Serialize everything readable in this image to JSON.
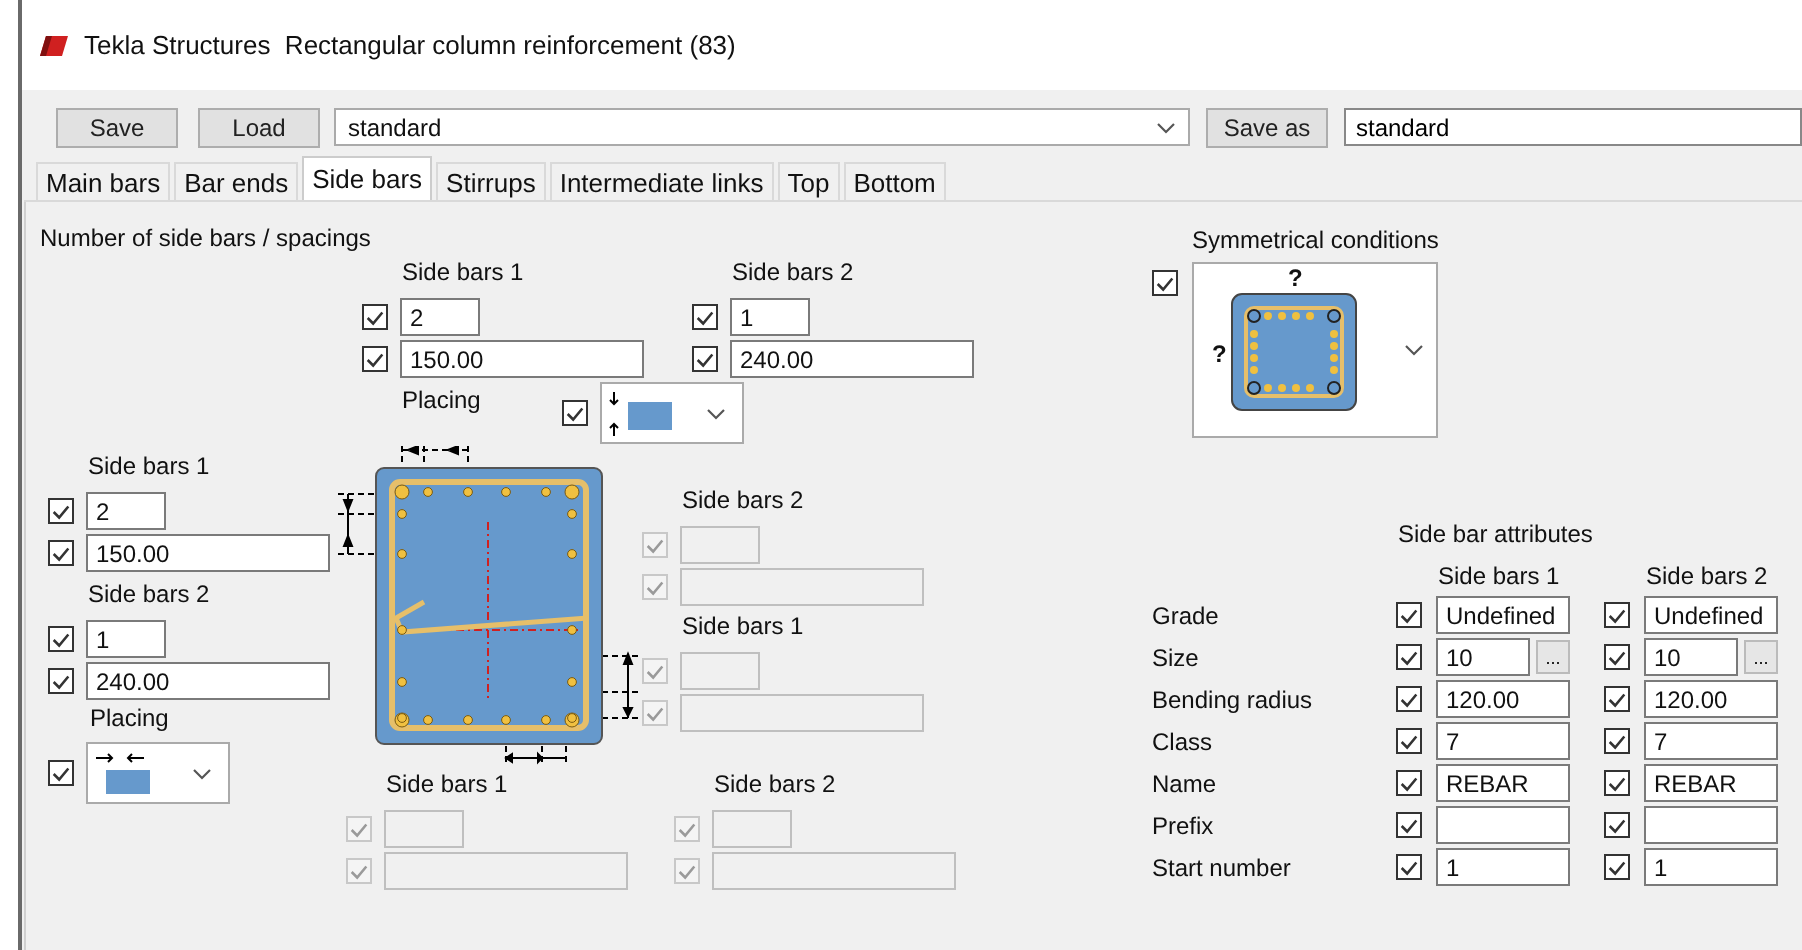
{
  "window": {
    "title": "Tekla Structures  Rectangular column reinforcement (83)"
  },
  "toolbar": {
    "save": "Save",
    "load": "Load",
    "preset": "standard",
    "save_as": "Save as",
    "save_as_name": "standard"
  },
  "tabs": [
    {
      "label": "Main bars",
      "selected": false
    },
    {
      "label": "Bar ends",
      "selected": false
    },
    {
      "label": "Side bars",
      "selected": true
    },
    {
      "label": "Stirrups",
      "selected": false
    },
    {
      "label": "Intermediate links",
      "selected": false
    },
    {
      "label": "Top",
      "selected": false
    },
    {
      "label": "Bottom",
      "selected": false
    }
  ],
  "spacing": {
    "title": "Number of side bars / spacings",
    "top": {
      "groups": [
        {
          "label": "Side bars 1",
          "fields": [
            {
              "kind": "count",
              "value": "2",
              "checked": true,
              "disabled": false
            },
            {
              "kind": "spacing",
              "value": "150.00",
              "checked": true,
              "disabled": false
            }
          ]
        },
        {
          "label": "Side bars 2",
          "fields": [
            {
              "kind": "count",
              "value": "1",
              "checked": true,
              "disabled": false
            },
            {
              "kind": "spacing",
              "value": "240.00",
              "checked": true,
              "disabled": false
            }
          ]
        }
      ],
      "placing": {
        "label": "Placing",
        "checked": true
      }
    },
    "left": {
      "groups": [
        {
          "label": "Side bars 1",
          "fields": [
            {
              "kind": "count",
              "value": "2",
              "checked": true,
              "disabled": false
            },
            {
              "kind": "spacing",
              "value": "150.00",
              "checked": true,
              "disabled": false
            }
          ]
        },
        {
          "label": "Side bars 2",
          "fields": [
            {
              "kind": "count",
              "value": "1",
              "checked": true,
              "disabled": false
            },
            {
              "kind": "spacing",
              "value": "240.00",
              "checked": true,
              "disabled": false
            }
          ]
        }
      ],
      "placing": {
        "label": "Placing",
        "checked": true
      }
    },
    "right": {
      "groups": [
        {
          "label": "Side bars 2",
          "fields": [
            {
              "kind": "count",
              "checked": true,
              "disabled": true
            },
            {
              "kind": "spacing",
              "checked": true,
              "disabled": true
            }
          ]
        },
        {
          "label": "Side bars 1",
          "fields": [
            {
              "kind": "count",
              "checked": true,
              "disabled": true
            },
            {
              "kind": "spacing",
              "checked": true,
              "disabled": true
            }
          ]
        }
      ]
    },
    "bottom": {
      "groups": [
        {
          "label": "Side bars 1",
          "fields": [
            {
              "kind": "count",
              "checked": true,
              "disabled": true
            },
            {
              "kind": "spacing",
              "checked": true,
              "disabled": true
            }
          ]
        },
        {
          "label": "Side bars 2",
          "fields": [
            {
              "kind": "count",
              "checked": true,
              "disabled": true
            },
            {
              "kind": "spacing",
              "checked": true,
              "disabled": true
            }
          ]
        }
      ]
    }
  },
  "symmetry": {
    "title": "Symmetrical conditions",
    "checked": true,
    "marks": [
      "?",
      "?"
    ]
  },
  "attributes": {
    "title": "Side bar attributes",
    "columns": [
      "Side bars 1",
      "Side bars 2"
    ],
    "rows": [
      {
        "label": "Grade",
        "kind": "text",
        "cells": [
          {
            "value": "Undefined",
            "checked": true
          },
          {
            "value": "Undefined",
            "checked": true
          }
        ]
      },
      {
        "label": "Size",
        "kind": "browse",
        "cells": [
          {
            "value": "10",
            "checked": true,
            "button": "..."
          },
          {
            "value": "10",
            "checked": true,
            "button": "..."
          }
        ]
      },
      {
        "label": "Bending radius",
        "kind": "text",
        "cells": [
          {
            "value": "120.00",
            "checked": true
          },
          {
            "value": "120.00",
            "checked": true
          }
        ]
      },
      {
        "label": "Class",
        "kind": "text",
        "cells": [
          {
            "value": "7",
            "checked": true
          },
          {
            "value": "7",
            "checked": true
          }
        ]
      },
      {
        "label": "Name",
        "kind": "text",
        "cells": [
          {
            "value": "REBAR",
            "checked": true
          },
          {
            "value": "REBAR",
            "checked": true
          }
        ]
      },
      {
        "label": "Prefix",
        "kind": "text",
        "cells": [
          {
            "checked": true
          },
          {
            "checked": true
          }
        ]
      },
      {
        "label": "Start number",
        "kind": "text",
        "cells": [
          {
            "value": "1",
            "checked": true
          },
          {
            "value": "1",
            "checked": true
          }
        ]
      }
    ]
  }
}
